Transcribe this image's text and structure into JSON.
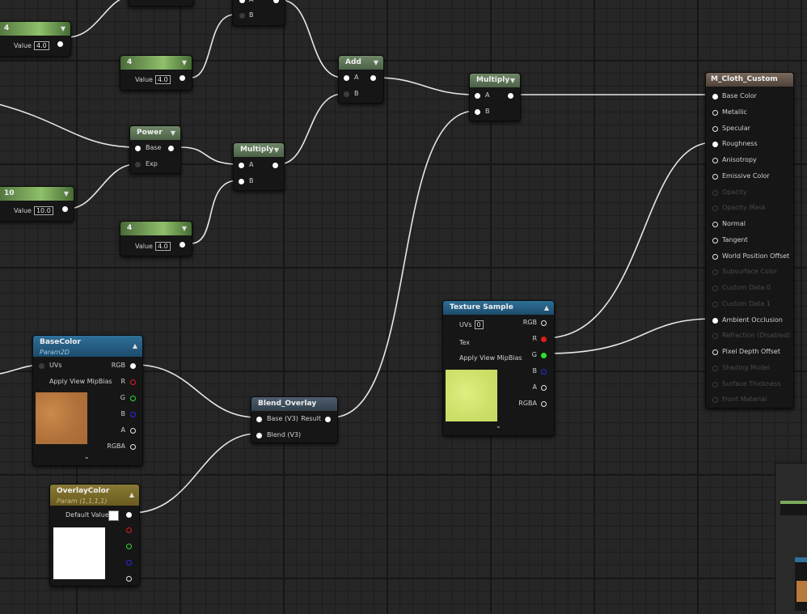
{
  "const_4_top": {
    "title": "4",
    "value_label": "Value",
    "value": "4.0"
  },
  "const_4_mid": {
    "title": "4",
    "value_label": "Value",
    "value": "4.0"
  },
  "const_10": {
    "title": "10",
    "value_label": "Value",
    "value": "10.0"
  },
  "const_4_low": {
    "title": "4",
    "value_label": "Value",
    "value": "4.0"
  },
  "top_partial": {
    "pin_a": "A",
    "pin_b": "B"
  },
  "power": {
    "title": "Power",
    "pin_base": "Base",
    "pin_exp": "Exp"
  },
  "multiply_1": {
    "title": "Multiply",
    "pin_a": "A",
    "pin_b": "B"
  },
  "add": {
    "title": "Add",
    "pin_a": "A",
    "pin_b": "B"
  },
  "multiply_2": {
    "title": "Multiply",
    "pin_a": "A",
    "pin_b": "B"
  },
  "basecolor": {
    "title": "BaseColor",
    "subtitle": "Param2D",
    "pin_uvs": "UVs",
    "pin_mip": "Apply View MipBias",
    "out_rgb": "RGB",
    "out_r": "R",
    "out_g": "G",
    "out_b": "B",
    "out_a": "A",
    "out_rgba": "RGBA",
    "texture_color": "#b8793d"
  },
  "overlaycolor": {
    "title": "OverlayColor",
    "subtitle": "Param (1,1,1,1)",
    "default_label": "Default Value",
    "swatch_color": "#ffffff"
  },
  "blend_overlay": {
    "title": "Blend_Overlay",
    "pin_base": "Base (V3)",
    "pin_blend": "Blend (V3)",
    "out_result": "Result"
  },
  "texture_sample": {
    "title": "Texture Sample",
    "pin_uvs": "UVs",
    "uvs_value": "0",
    "pin_tex": "Tex",
    "pin_mip": "Apply View MipBias",
    "out_rgb": "RGB",
    "out_r": "R",
    "out_g": "G",
    "out_b": "B",
    "out_a": "A",
    "out_rgba": "RGBA",
    "texture_color": "#d4e86a"
  },
  "material": {
    "title": "M_Cloth_Custom",
    "inputs": [
      {
        "label": "Base Color",
        "active": true
      },
      {
        "label": "Metallic",
        "active": true
      },
      {
        "label": "Specular",
        "active": true
      },
      {
        "label": "Roughness",
        "active": true
      },
      {
        "label": "Anisotropy",
        "active": true
      },
      {
        "label": "Emissive Color",
        "active": true
      },
      {
        "label": "Opacity",
        "active": false
      },
      {
        "label": "Opacity Mask",
        "active": false
      },
      {
        "label": "Normal",
        "active": true
      },
      {
        "label": "Tangent",
        "active": true
      },
      {
        "label": "World Position Offset",
        "active": true
      },
      {
        "label": "Subsurface Color",
        "active": false
      },
      {
        "label": "Custom Data 0",
        "active": false
      },
      {
        "label": "Custom Data 1",
        "active": false
      },
      {
        "label": "Ambient Occlusion",
        "active": true
      },
      {
        "label": "Refraction (Disabled)",
        "active": false
      },
      {
        "label": "Pixel Depth Offset",
        "active": true
      },
      {
        "label": "Shading Model",
        "active": false
      },
      {
        "label": "Surface Thickness",
        "active": false
      },
      {
        "label": "Front Material",
        "active": false
      }
    ]
  },
  "colors": {
    "wire": "#e8e8e8",
    "grid_major": "#161616",
    "background": "#262626"
  },
  "icons": {
    "chevron_down": "▼",
    "chevron_up": "▲",
    "expand": "⌄"
  }
}
